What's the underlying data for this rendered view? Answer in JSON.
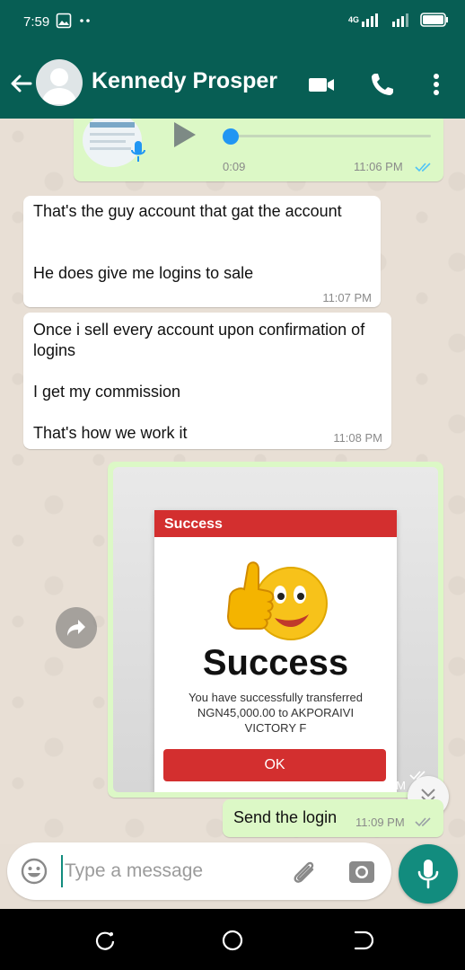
{
  "status_bar": {
    "time": "7:59",
    "network": "4G"
  },
  "header": {
    "contact_name": "Kennedy Prosper"
  },
  "voice_message": {
    "duration": "0:09",
    "time": "11:06 PM",
    "progress": 0
  },
  "messages": [
    {
      "direction": "incoming",
      "text": "That's the guy account that gat the account\n\n\nHe does give me logins to sale",
      "time": "11:07 PM"
    },
    {
      "direction": "incoming",
      "text": "Once i sell every account upon confirmation of logins\n\nI get my commission\n\nThat's how we work it",
      "time": "11:08 PM"
    }
  ],
  "image_message": {
    "time": "11:09 PM",
    "dialog_header": "Success",
    "big_text": "Success",
    "description": "You have successfully transferred NGN45,000.00 to AKPORAIVI VICTORY F",
    "ok_label": "OK"
  },
  "last_message": {
    "text": "Send the login",
    "time": "11:09 PM"
  },
  "input": {
    "placeholder": "Type a message"
  },
  "colors": {
    "header": "#075e54",
    "outgoing": "#dcf8c6",
    "accent": "#128c7e",
    "tick_read": "#4fc3f7",
    "success_red": "#d32f2f"
  }
}
